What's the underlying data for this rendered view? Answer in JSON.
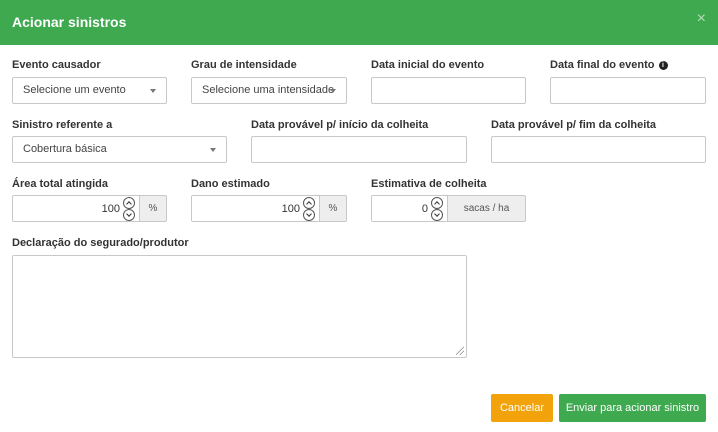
{
  "modal": {
    "title": "Acionar sinistros",
    "close_symbol": "×"
  },
  "form": {
    "evento_causador": {
      "label": "Evento causador",
      "placeholder": "Selecione um evento"
    },
    "grau_intensidade": {
      "label": "Grau de intensidade",
      "placeholder": "Selecione uma intensidade"
    },
    "data_inicial": {
      "label": "Data inicial do evento",
      "value": ""
    },
    "data_final": {
      "label": "Data final do evento",
      "info_symbol": "i",
      "value": ""
    },
    "sinistro_referente": {
      "label": "Sinistro referente a",
      "value": "Cobertura básica"
    },
    "data_inicio_colheita": {
      "label": "Data provável p/ início da colheita",
      "value": ""
    },
    "data_fim_colheita": {
      "label": "Data provável p/ fim da colheita",
      "value": ""
    },
    "area_total": {
      "label": "Área total atingida",
      "value": "100",
      "unit": "%"
    },
    "dano_estimado": {
      "label": "Dano estimado",
      "value": "100",
      "unit": "%"
    },
    "estimativa_colheita": {
      "label": "Estimativa de colheita",
      "value": "0",
      "unit": "sacas / ha"
    },
    "declaracao": {
      "label": "Declaração do segurado/produtor",
      "value": ""
    }
  },
  "buttons": {
    "cancel": "Cancelar",
    "submit": "Enviar para acionar sinistro"
  },
  "colors": {
    "header": "#3fa94f",
    "cancel": "#f2a20a",
    "submit": "#3fa94f"
  },
  "icons": {
    "close": "close-icon",
    "info": "info-icon",
    "spinner_up": "chevron-up-icon",
    "spinner_down": "chevron-down-icon",
    "select_caret": "caret-down-icon",
    "resize": "resize-grip-icon"
  }
}
